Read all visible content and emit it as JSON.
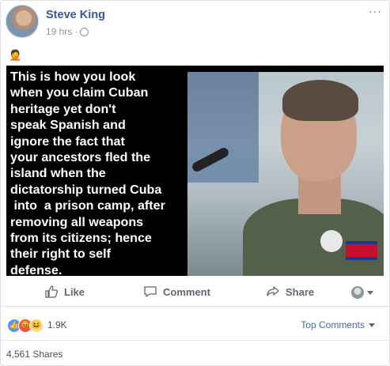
{
  "post": {
    "author": "Steve King",
    "time": "19 hrs",
    "separator": "·",
    "more_label": "···",
    "text_emoji": "🤦",
    "image": {
      "caption": "This is how you look\nwhen you claim Cuban\nheritage yet don't\nspeak Spanish and\nignore the fact that\nyour ancestors fled the\nisland when the\ndictatorship turned Cuba\n into  a prison camp, after\nremoving all weapons\nfrom its citizens; hence\ntheir right to self\ndefense."
    }
  },
  "actions": {
    "like": "Like",
    "comment": "Comment",
    "share": "Share"
  },
  "reactions": {
    "icons": [
      "like-icon",
      "angry-icon",
      "haha-icon"
    ],
    "count": "1.9K",
    "sort_label": "Top Comments"
  },
  "shares": "4,561 Shares",
  "colors": {
    "link": "#365899",
    "accent": "#4267b2",
    "muted": "#90949c"
  }
}
